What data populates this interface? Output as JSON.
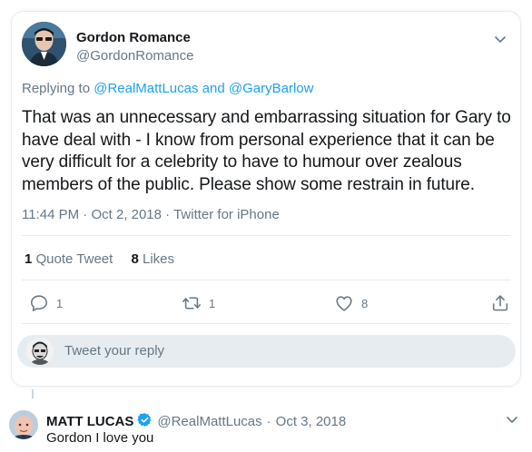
{
  "tweet": {
    "author_name": "Gordon Romance",
    "author_handle": "@GordonRomance",
    "replying_prefix": "Replying to",
    "replying_mention_1": "@RealMattLucas",
    "replying_and": "and",
    "replying_mention_2": "@GaryBarlow",
    "text": "That was an unnecessary and embarrassing situation for Gary to have deal with - I know from personal experience that it can be very difficult for a celebrity to have to humour over zealous members of the public. Please show some restrain in future.",
    "time": "11:44 PM",
    "date": "Oct 2, 2018",
    "separator": "·",
    "source": "Twitter for iPhone",
    "quote_tweets_count": "1",
    "quote_tweets_label": "Quote Tweet",
    "likes_count": "8",
    "likes_label": "Likes",
    "reply_count": "1",
    "retweet_count": "1",
    "like_count": "8"
  },
  "reply_box": {
    "placeholder": "Tweet your reply"
  },
  "reply_tweet": {
    "author_name": "MATT LUCAS",
    "author_handle": "@RealMattLucas",
    "separator": "·",
    "date": "Oct 3, 2018",
    "text": "Gordon I love you"
  },
  "colors": {
    "link_blue": "#1da1f2",
    "muted_gray": "#657786",
    "border": "#e6ecf0",
    "text": "#14171a",
    "verified_blue": "#1da1f2"
  },
  "icons": {
    "caret": "chevron-down-icon",
    "reply": "reply-icon",
    "retweet": "retweet-icon",
    "like": "heart-icon",
    "share": "share-icon",
    "verified": "verified-badge-icon"
  }
}
